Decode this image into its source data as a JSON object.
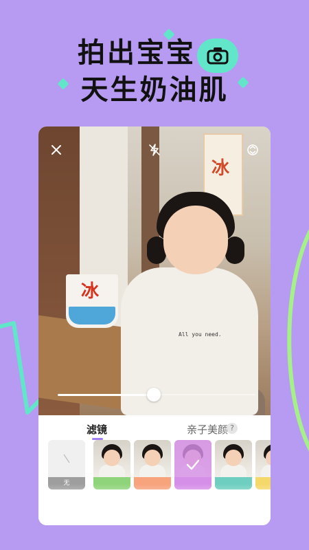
{
  "headline": {
    "line1": "拍出宝宝",
    "line2": "天生奶油肌"
  },
  "icons": {
    "camera": "camera-icon",
    "close": "close-icon",
    "flash": "flash-off-icon",
    "switch": "camera-switch-icon",
    "check": "check-icon",
    "help": "help-icon"
  },
  "photo": {
    "sign_text": "冰",
    "cup_text": "冰",
    "shirt_text": "All you need."
  },
  "slider": {
    "level_fraction": 0.54
  },
  "tabs": {
    "filter_label": "滤镜",
    "beauty_label": "亲子美颜",
    "help_symbol": "?"
  },
  "filters": [
    {
      "label": "无",
      "color": "#9e9e9e"
    },
    {
      "label": "",
      "color": "#8fd47a"
    },
    {
      "label": "",
      "color": "#f7a37b"
    },
    {
      "label": "",
      "color": "#d98fe8",
      "selected": true
    },
    {
      "label": "",
      "color": "#6ecfc0"
    },
    {
      "label": "",
      "color": "#f5d86a"
    }
  ],
  "colors": {
    "background": "#b79af2",
    "accent_mint": "#62e6c9",
    "tab_accent": "#a07ef0"
  }
}
